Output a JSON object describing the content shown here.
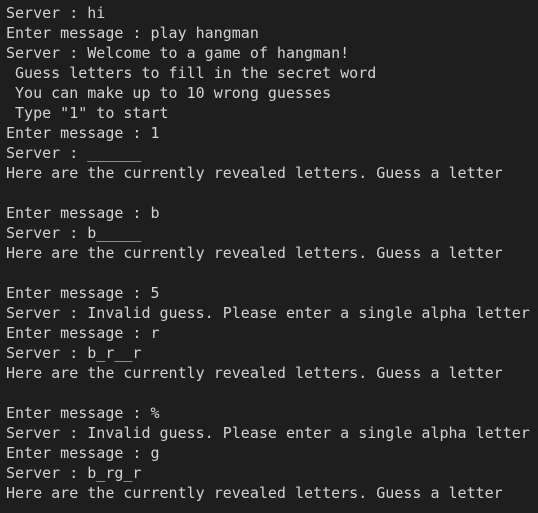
{
  "terminal": {
    "lines": [
      "Server : hi",
      "Enter message : play hangman",
      "Server : Welcome to a game of hangman!",
      " Guess letters to fill in the secret word",
      " You can make up to 10 wrong guesses",
      " Type \"1\" to start",
      "Enter message : 1",
      "Server : ______",
      "Here are the currently revealed letters. Guess a letter",
      "",
      "Enter message : b",
      "Server : b_____",
      "Here are the currently revealed letters. Guess a letter",
      "",
      "Enter message : 5",
      "Server : Invalid guess. Please enter a single alpha letter",
      "Enter message : r",
      "Server : b_r__r",
      "Here are the currently revealed letters. Guess a letter",
      "",
      "Enter message : %",
      "Server : Invalid guess. Please enter a single alpha letter",
      "Enter message : g",
      "Server : b_rg_r",
      "Here are the currently revealed letters. Guess a letter"
    ]
  }
}
